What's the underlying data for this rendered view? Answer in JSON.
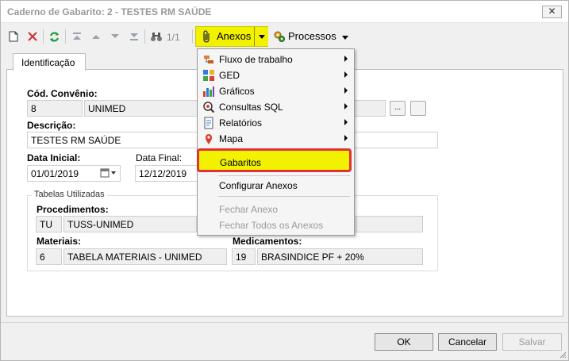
{
  "window": {
    "title": "Caderno de Gabarito: 2 - TESTES RM SAÚDE",
    "close_label": "✕"
  },
  "toolbar": {
    "pager": "1/1",
    "anexos_label": "Anexos",
    "processos_label": "Processos"
  },
  "tabs": [
    {
      "label": "Identificação"
    }
  ],
  "form": {
    "convenio_label": "Cód. Convênio:",
    "convenio_code": "8",
    "convenio_name": "UNIMED",
    "lookup_button": "...",
    "descricao_label": "Descrição:",
    "descricao_value": "TESTES RM SAÚDE",
    "data_inicial_label": "Data Inicial:",
    "data_inicial_value": "01/01/2019",
    "data_final_label": "Data Final:",
    "data_final_value": "12/12/2019",
    "tabelas_legend": "Tabelas Utilizadas",
    "procedimentos_label": "Procedimentos:",
    "procedimentos_code": "TU",
    "procedimentos_name": "TUSS-UNIMED",
    "materiais_label": "Materiais:",
    "materiais_code": "6",
    "materiais_name": "TABELA MATERIAIS - UNIMED",
    "medicamentos_label": "Medicamentos:",
    "medicamentos_code": "19",
    "medicamentos_name": "BRASINDICE PF + 20%"
  },
  "menu": {
    "items": [
      {
        "label": "Fluxo de trabalho",
        "submenu": true,
        "icon": "workflow-icon"
      },
      {
        "label": "GED",
        "submenu": true,
        "icon": "ged-icon"
      },
      {
        "label": "Gráficos",
        "submenu": true,
        "icon": "chart-icon"
      },
      {
        "label": "Consultas SQL",
        "submenu": true,
        "icon": "sql-icon"
      },
      {
        "label": "Relatórios",
        "submenu": true,
        "icon": "report-icon"
      },
      {
        "label": "Mapa",
        "submenu": true,
        "icon": "map-pin-icon"
      }
    ],
    "gabaritos": "Gabaritos",
    "configurar": "Configurar Anexos",
    "fechar_anexo": "Fechar Anexo",
    "fechar_todos": "Fechar Todos os Anexos"
  },
  "footer": {
    "ok": "OK",
    "cancelar": "Cancelar",
    "salvar": "Salvar"
  },
  "colors": {
    "highlight": "#f2f200",
    "callout_border": "#e0323a",
    "refresh_green": "#1e9e3a",
    "delete_red": "#d32f2f"
  }
}
